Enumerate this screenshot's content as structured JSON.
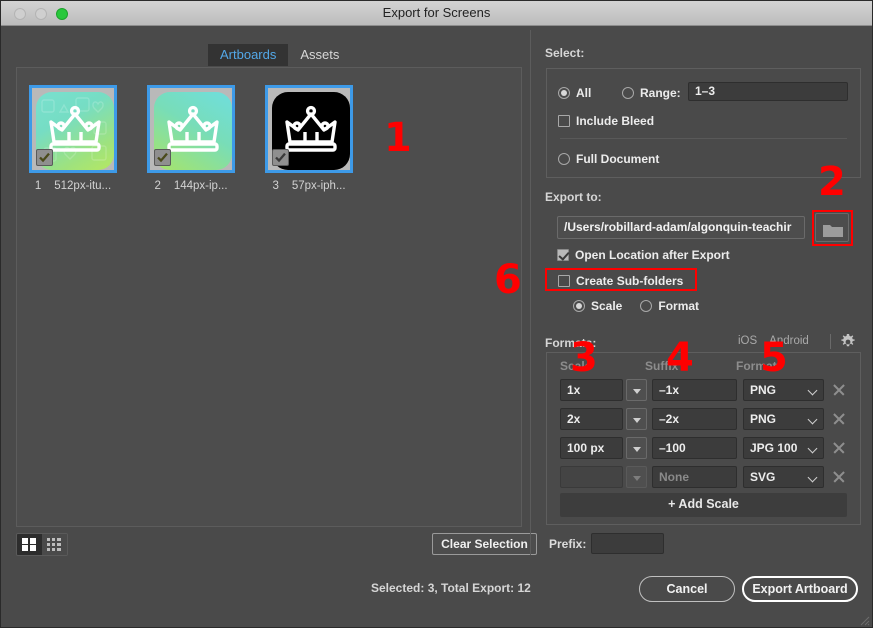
{
  "window": {
    "title": "Export for Screens",
    "traffic_lights": [
      "close-button",
      "minimize-button",
      "zoom-button"
    ]
  },
  "tabs": [
    {
      "label": "Artboards",
      "active": true
    },
    {
      "label": "Assets",
      "active": false
    }
  ],
  "artboards": [
    {
      "num": "1",
      "name": "512px-itu...",
      "checked": true,
      "style": "gradient-teal-green"
    },
    {
      "num": "2",
      "name": "144px-ip...",
      "checked": true,
      "style": "gradient-cyan-green"
    },
    {
      "num": "3",
      "name": "57px-iph...",
      "checked": true,
      "style": "black"
    }
  ],
  "view_toggle": {
    "grid": "grid-view",
    "list": "list-view",
    "active": "grid"
  },
  "clear_selection_label": "Clear Selection",
  "select": {
    "label": "Select:",
    "all_label": "All",
    "all_checked": true,
    "range_label": "Range:",
    "range_checked": false,
    "range_value": "1–3",
    "include_bleed_label": "Include Bleed",
    "include_bleed_checked": false,
    "full_document_label": "Full Document",
    "full_document_checked": false
  },
  "export_to": {
    "label": "Export to:",
    "path": "/Users/robillard-adam/algonquin-teachir",
    "folder_button": "folder-icon",
    "open_location_label": "Open Location after Export",
    "open_location_checked": true,
    "create_subfolders_label": "Create Sub-folders",
    "create_subfolders_checked": false,
    "scale_label": "Scale",
    "scale_checked": true,
    "format_label": "Format",
    "format_checked": false
  },
  "formats": {
    "label": "Formats:",
    "os_ios": "iOS",
    "os_android": "Android",
    "gear": "gear-icon",
    "columns": [
      "Scale",
      "Suffix",
      "Format"
    ],
    "rows": [
      {
        "scale": "1x",
        "scale_placeholder": "",
        "suffix": "–1x",
        "suffix_placeholder": "",
        "format": "PNG",
        "enabled": true
      },
      {
        "scale": "2x",
        "scale_placeholder": "",
        "suffix": "–2x",
        "suffix_placeholder": "",
        "format": "PNG",
        "enabled": true
      },
      {
        "scale": "100 px",
        "scale_placeholder": "",
        "suffix": "–100",
        "suffix_placeholder": "",
        "format": "JPG 100",
        "enabled": true
      },
      {
        "scale": "",
        "scale_placeholder": "",
        "suffix": "",
        "suffix_placeholder": "None",
        "format": "SVG",
        "enabled": false
      }
    ],
    "add_scale_label": "+ Add Scale"
  },
  "bottom": {
    "prefix_label": "Prefix:",
    "prefix_value": "",
    "status": "Selected: 3, Total Export: 12",
    "cancel_label": "Cancel",
    "export_label": "Export Artboard"
  },
  "annotations": [
    {
      "id": "1",
      "text": "1"
    },
    {
      "id": "2",
      "text": "2"
    },
    {
      "id": "3",
      "text": "3"
    },
    {
      "id": "4",
      "text": "4"
    },
    {
      "id": "5",
      "text": "5"
    },
    {
      "id": "6",
      "text": "6"
    }
  ],
  "colors": {
    "accent_blue": "#3d9ae8",
    "annotation_red": "#ff0000",
    "window_bg": "#4a4a4a",
    "tab_active_text": "#53a8e8"
  }
}
